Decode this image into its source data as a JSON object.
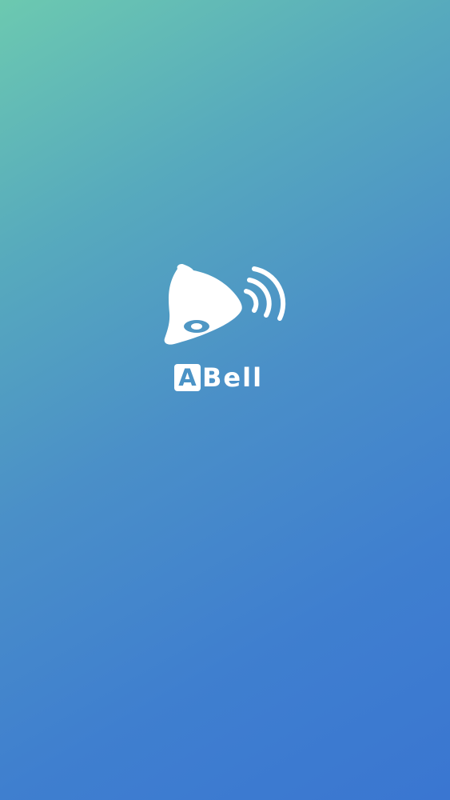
{
  "app": {
    "name_initial": "A",
    "name_rest": "Bell"
  },
  "logo": {
    "icon": "bell-ringing-icon"
  },
  "colors": {
    "gradient_start": "#6cc9b0",
    "gradient_end": "#3a76d1",
    "logo": "#ffffff"
  }
}
